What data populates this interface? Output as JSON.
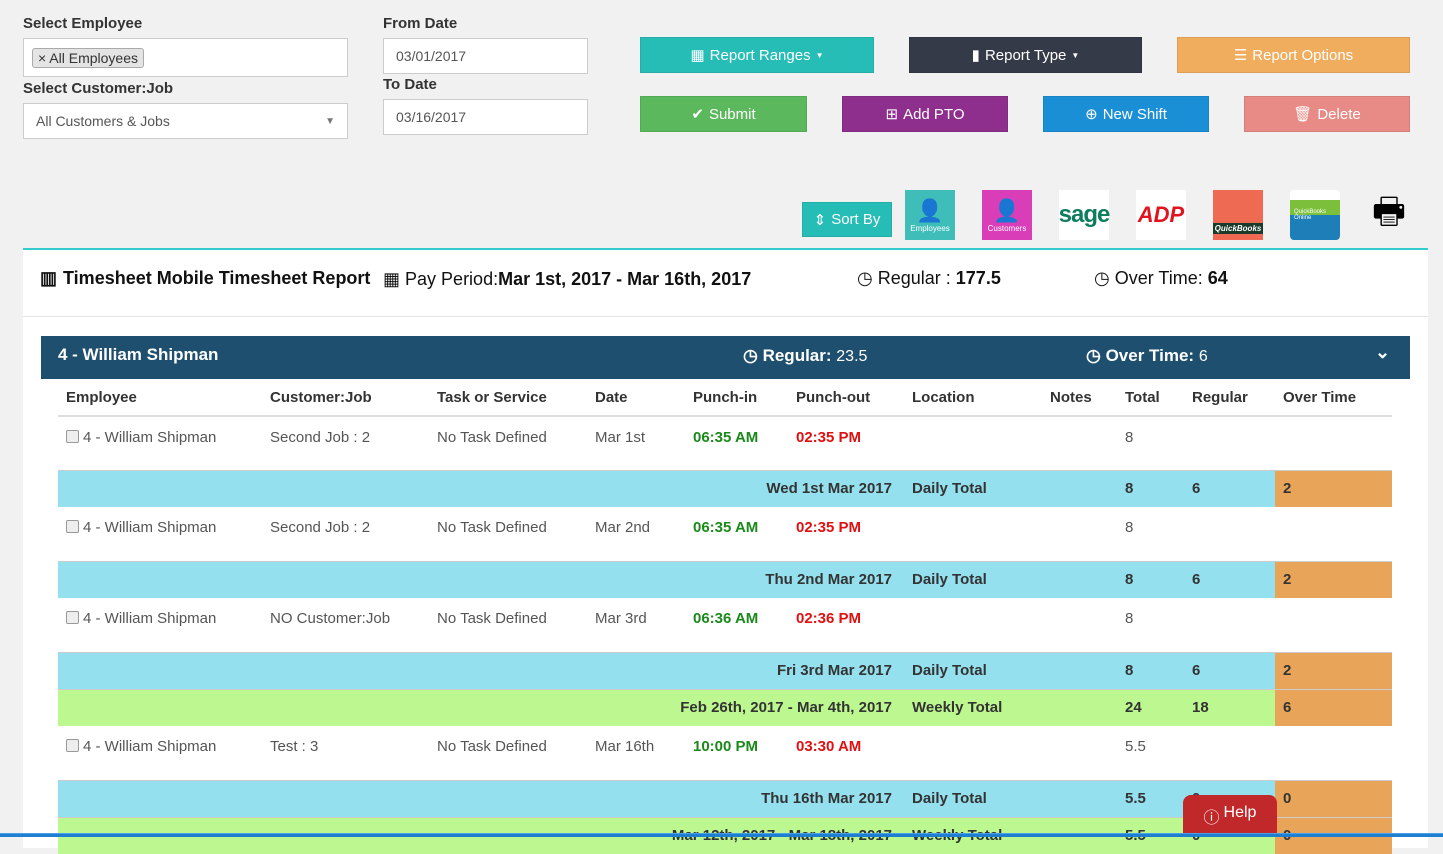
{
  "filters": {
    "employee_label": "Select Employee",
    "employee_tag": "All Employees",
    "customer_label": "Select Customer:Job",
    "customer_value": "All Customers & Jobs",
    "from_label": "From Date",
    "from_value": "03/01/2017",
    "to_label": "To Date",
    "to_value": "03/16/2017"
  },
  "buttons": {
    "report_ranges": "Report Ranges",
    "report_type": "Report Type",
    "report_options": "Report Options",
    "submit": "Submit",
    "add_pto": "Add PTO",
    "new_shift": "New Shift",
    "delete": "Delete",
    "sort_by": "Sort By",
    "help": "Help"
  },
  "exports": {
    "employees": "Employees",
    "customers": "Customers",
    "sage": "sage",
    "adp": "ADP",
    "quickbooks": "QuickBooks",
    "qbo": "QuickBooks Online"
  },
  "colors": {
    "teal": "#26bdb6",
    "dark": "#343a47",
    "orange": "#f0ad5e",
    "green": "#5cb85c",
    "purple": "#8e2f8e",
    "blue": "#1b8fd6",
    "red": "#e88a86",
    "header": "#1f4f6e"
  },
  "report": {
    "title": "Timesheet Mobile Timesheet Report",
    "pay_period_label": "Pay Period:",
    "pay_period": "Mar 1st, 2017 - Mar 16th, 2017",
    "regular_label": "Regular : ",
    "regular": "177.5",
    "overtime_label": "Over Time: ",
    "overtime": "64"
  },
  "employee_block": {
    "name": "4 - William Shipman",
    "regular_label": "Regular:",
    "regular": "23.5",
    "overtime_label": "Over Time:",
    "overtime": "6"
  },
  "columns": [
    "Employee",
    "Customer:Job",
    "Task or Service",
    "Date",
    "Punch-in",
    "Punch-out",
    "Location",
    "Notes",
    "Total",
    "Regular",
    "Over Time"
  ],
  "rows": [
    {
      "type": "data",
      "employee": "4 - William Shipman",
      "job": "Second Job : 2",
      "task": "No Task Defined",
      "date": "Mar 1st",
      "in": "06:35 AM",
      "out": "02:35 PM",
      "total": "8"
    },
    {
      "type": "day",
      "label": "Wed 1st Mar 2017",
      "kind": "Daily Total",
      "total": "8",
      "regular": "6",
      "ot": "2"
    },
    {
      "type": "data",
      "employee": "4 - William Shipman",
      "job": "Second Job : 2",
      "task": "No Task Defined",
      "date": "Mar 2nd",
      "in": "06:35 AM",
      "out": "02:35 PM",
      "total": "8"
    },
    {
      "type": "day",
      "label": "Thu 2nd Mar 2017",
      "kind": "Daily Total",
      "total": "8",
      "regular": "6",
      "ot": "2"
    },
    {
      "type": "data",
      "employee": "4 - William Shipman",
      "job": "NO Customer:Job",
      "task": "No Task Defined",
      "date": "Mar 3rd",
      "in": "06:36 AM",
      "out": "02:36 PM",
      "total": "8"
    },
    {
      "type": "day",
      "label": "Fri 3rd Mar 2017",
      "kind": "Daily Total",
      "total": "8",
      "regular": "6",
      "ot": "2"
    },
    {
      "type": "week",
      "label": "Feb 26th, 2017  -  Mar 4th, 2017",
      "kind": "Weekly Total",
      "total": "24",
      "regular": "18",
      "ot": "6"
    },
    {
      "type": "data",
      "employee": "4 - William Shipman",
      "job": "Test : 3",
      "task": "No Task Defined",
      "date": "Mar 16th",
      "in": "10:00 PM",
      "out": "03:30 AM",
      "total": "5.5"
    },
    {
      "type": "day",
      "label": "Thu 16th Mar 2017",
      "kind": "Daily Total",
      "total": "5.5",
      "regular": "0",
      "ot": "0"
    },
    {
      "type": "week",
      "label": "Mar 12th, 2017  -  Mar 18th, 2017",
      "kind": "Weekly Total",
      "total": "5.5",
      "regular": "0",
      "ot": "0"
    }
  ]
}
